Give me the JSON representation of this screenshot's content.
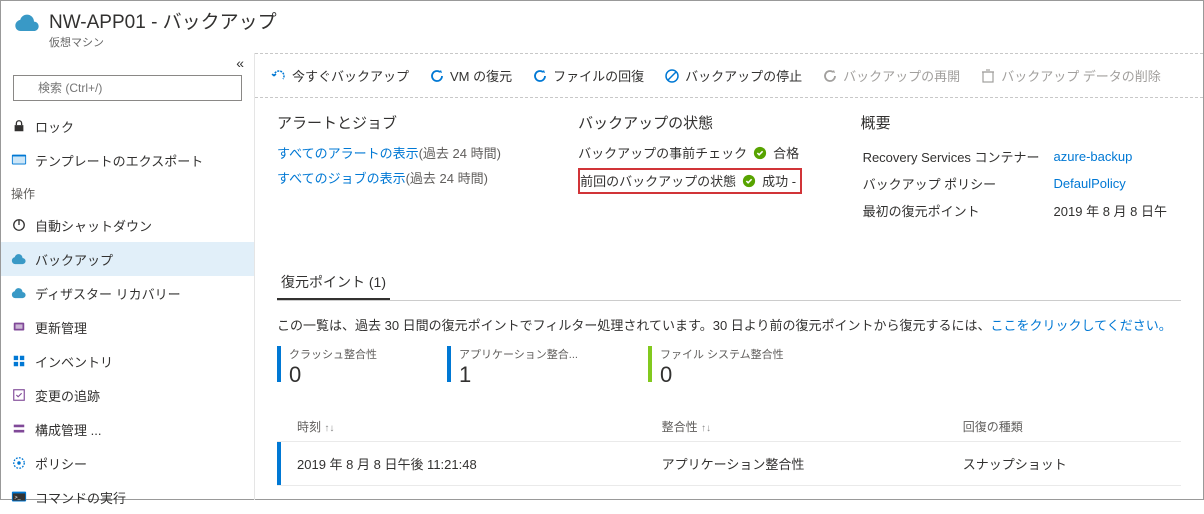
{
  "header": {
    "title": "NW-APP01 - バックアップ",
    "sub": "仮想マシン"
  },
  "sidebar": {
    "collapse": "«",
    "search_placeholder": "検索 (Ctrl+/)",
    "top": [
      {
        "label": "ロック"
      },
      {
        "label": "テンプレートのエクスポート"
      }
    ],
    "section": "操作",
    "ops": [
      {
        "label": "自動シャットダウン"
      },
      {
        "label": "バックアップ",
        "active": true
      },
      {
        "label": "ディザスター リカバリー"
      },
      {
        "label": "更新管理"
      },
      {
        "label": "インベントリ"
      },
      {
        "label": "変更の追跡"
      },
      {
        "label": "構成管理 ..."
      },
      {
        "label": "ポリシー"
      },
      {
        "label": "コマンドの実行"
      }
    ]
  },
  "toolbar": {
    "backup_now": "今すぐバックアップ",
    "restore_vm": "VM の復元",
    "file_recovery": "ファイルの回復",
    "stop_backup": "バックアップの停止",
    "resume_backup": "バックアップの再開",
    "delete_data": "バックアップ データの削除"
  },
  "alerts": {
    "title": "アラートとジョブ",
    "show_all_alerts": "すべてのアラートの表示",
    "alerts_suffix": "(過去 24 時間)",
    "show_all_jobs": "すべてのジョブの表示",
    "jobs_suffix": "(過去 24 時間)"
  },
  "status": {
    "title": "バックアップの状態",
    "precheck_label": "バックアップの事前チェック",
    "precheck_value": "合格",
    "last_label": "前回のバックアップの状態",
    "last_value": "成功 -"
  },
  "summary": {
    "title": "概要",
    "rs_label": "Recovery Services コンテナー",
    "rs_value": "azure-backup",
    "policy_label": "バックアップ ポリシー",
    "policy_value": "DefaulPolicy",
    "first_rp_label": "最初の復元ポイント",
    "first_rp_value": "2019 年 8 月 8 日午"
  },
  "restore": {
    "tab": "復元ポイント (1)",
    "filter_text_1": "この一覧は、過去 30 日間の復元ポイントでフィルター処理されています。30 日より前の復元ポイントから復元するには、",
    "filter_link": "ここをクリックしてください。",
    "stats": [
      {
        "label": "クラッシュ整合性",
        "value": "0",
        "color": "blue"
      },
      {
        "label": "アプリケーション整合...",
        "value": "1",
        "color": "blue"
      },
      {
        "label": "ファイル システム整合性",
        "value": "0",
        "color": "green"
      }
    ],
    "table": {
      "headers": {
        "time": "時刻",
        "consistency": "整合性",
        "recovery_type": "回復の種類"
      },
      "row": {
        "time": "2019 年 8 月 8 日午後 11:21:48",
        "consistency": "アプリケーション整合性",
        "recovery_type": "スナップショット"
      }
    }
  }
}
